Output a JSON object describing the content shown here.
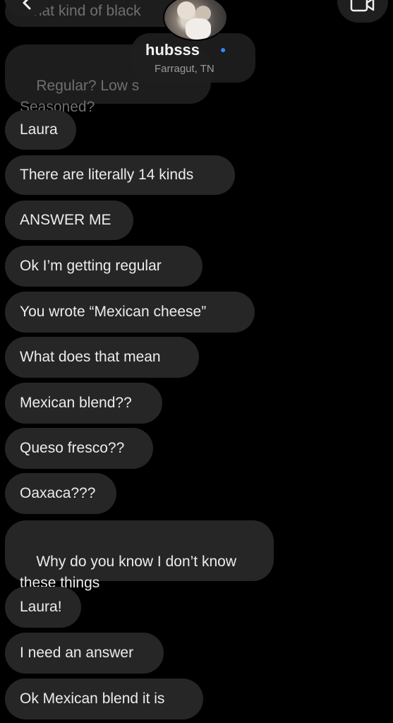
{
  "header": {
    "contact_name": "hubsss",
    "contact_location": "Farragut, TN",
    "back_icon": "chevron-left-icon",
    "video_icon": "video-call-icon"
  },
  "messages": [
    {
      "text": "What kind of black"
    },
    {
      "text": "Regular? Low s\nSeasoned?"
    },
    {
      "text": "Laura"
    },
    {
      "text": "There are literally 14 kinds"
    },
    {
      "text": "ANSWER ME"
    },
    {
      "text": "Ok I’m getting regular"
    },
    {
      "text": "You wrote “Mexican cheese”"
    },
    {
      "text": "What does that mean"
    },
    {
      "text": "Mexican blend??"
    },
    {
      "text": "Queso fresco??"
    },
    {
      "text": "Oaxaca???"
    },
    {
      "text": "Why do you know I don’t know\nthese things"
    },
    {
      "text": "Laura!"
    },
    {
      "text": "I need an answer"
    },
    {
      "text": "Ok Mexican blend it is"
    }
  ],
  "colors": {
    "background": "#000000",
    "bubble": "#262626",
    "text": "#ececec",
    "accent": "#3b82f6"
  }
}
